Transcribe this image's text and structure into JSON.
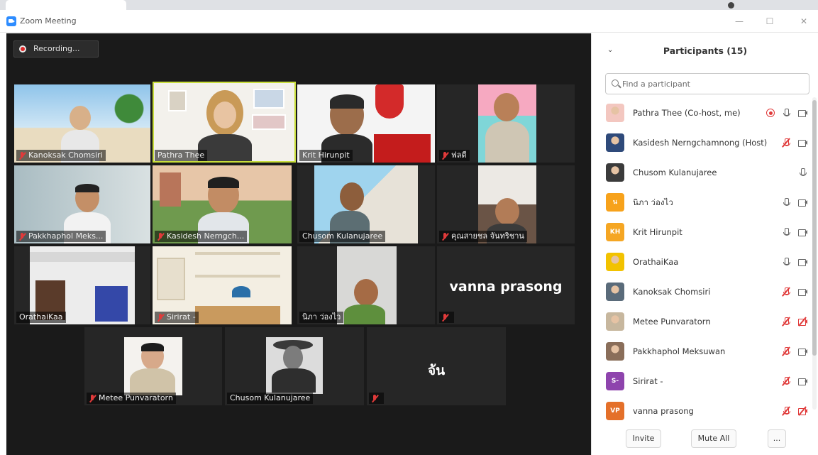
{
  "window": {
    "title": "Zoom Meeting",
    "minimize": "—",
    "maximize": "☐",
    "close": "✕"
  },
  "recording": {
    "label": "Recording..."
  },
  "gallery": [
    {
      "name": "Kanoksak Chomsiri",
      "muted": true
    },
    {
      "name": "Pathra Thee",
      "muted": false,
      "active": true
    },
    {
      "name": "Krit Hirunpit",
      "muted": false
    },
    {
      "name": "ฟลดี",
      "muted": true
    },
    {
      "name": "Pakkhaphol Meks...",
      "muted": true
    },
    {
      "name": "Kasidesh Nerngch...",
      "muted": true
    },
    {
      "name": "Chusom Kulanujaree",
      "muted": false
    },
    {
      "name": "คุณสายชล จันทริชาน",
      "muted": true
    },
    {
      "name": "OrathaiKaa",
      "muted": false
    },
    {
      "name": "Sirirat -",
      "muted": true
    },
    {
      "name": "นิภา ว่องไว",
      "muted": false
    },
    {
      "name": "",
      "big_name": "vanna prasong",
      "muted": true
    },
    {
      "name": "Metee Punvaratorn",
      "muted": true
    },
    {
      "name": "Chusom Kulanujaree",
      "muted": false
    },
    {
      "name": "",
      "big_name": "จัน",
      "muted": true
    }
  ],
  "panel": {
    "title": "Participants (15)",
    "collapse_icon": "chevron-down-icon",
    "search_placeholder": "Find a participant",
    "participants": [
      {
        "name": "Pathra Thee (Co-host, me)",
        "avatar_type": "photo",
        "avatar_color": "#f3c7c0",
        "icons": [
          "recording-icon",
          "mic-on-icon",
          "camera-icon"
        ]
      },
      {
        "name": "Kasidesh Nerngchamnong (Host)",
        "avatar_type": "photo",
        "avatar_color": "#2f4a7a",
        "icons": [
          "mic-off-icon",
          "camera-icon"
        ]
      },
      {
        "name": "Chusom Kulanujaree",
        "avatar_type": "photo",
        "avatar_color": "#3b3b3b",
        "icons": [
          "mic-on-icon"
        ]
      },
      {
        "name": "นิภา ว่องไว",
        "avatar_type": "initials",
        "initials": "น",
        "avatar_color": "#f7a21b",
        "icons": [
          "mic-on-icon",
          "camera-icon"
        ]
      },
      {
        "name": "Krit Hirunpit",
        "avatar_type": "initials",
        "initials": "KH",
        "avatar_color": "#f5a623",
        "icons": [
          "mic-on-icon",
          "camera-icon"
        ]
      },
      {
        "name": "OrathaiKaa",
        "avatar_type": "photo",
        "avatar_color": "#f2c200",
        "icons": [
          "mic-on-icon",
          "camera-icon"
        ]
      },
      {
        "name": "Kanoksak Chomsiri",
        "avatar_type": "photo",
        "avatar_color": "#5a6b7a",
        "icons": [
          "mic-off-icon",
          "camera-icon"
        ]
      },
      {
        "name": "Metee Punvaratorn",
        "avatar_type": "photo",
        "avatar_color": "#c7b79e",
        "icons": [
          "mic-off-icon",
          "camera-off-icon"
        ]
      },
      {
        "name": "Pakkhaphol Meksuwan",
        "avatar_type": "photo",
        "avatar_color": "#8a6e5a",
        "icons": [
          "mic-off-icon",
          "camera-icon"
        ]
      },
      {
        "name": "Sirirat -",
        "avatar_type": "initials",
        "initials": "S-",
        "avatar_color": "#8e44ad",
        "icons": [
          "mic-off-icon",
          "camera-icon"
        ]
      },
      {
        "name": "vanna prasong",
        "avatar_type": "initials",
        "initials": "VP",
        "avatar_color": "#e4702a",
        "icons": [
          "mic-off-icon",
          "camera-off-icon"
        ]
      }
    ],
    "invite_label": "Invite",
    "mute_all_label": "Mute All",
    "more_label": "..."
  }
}
